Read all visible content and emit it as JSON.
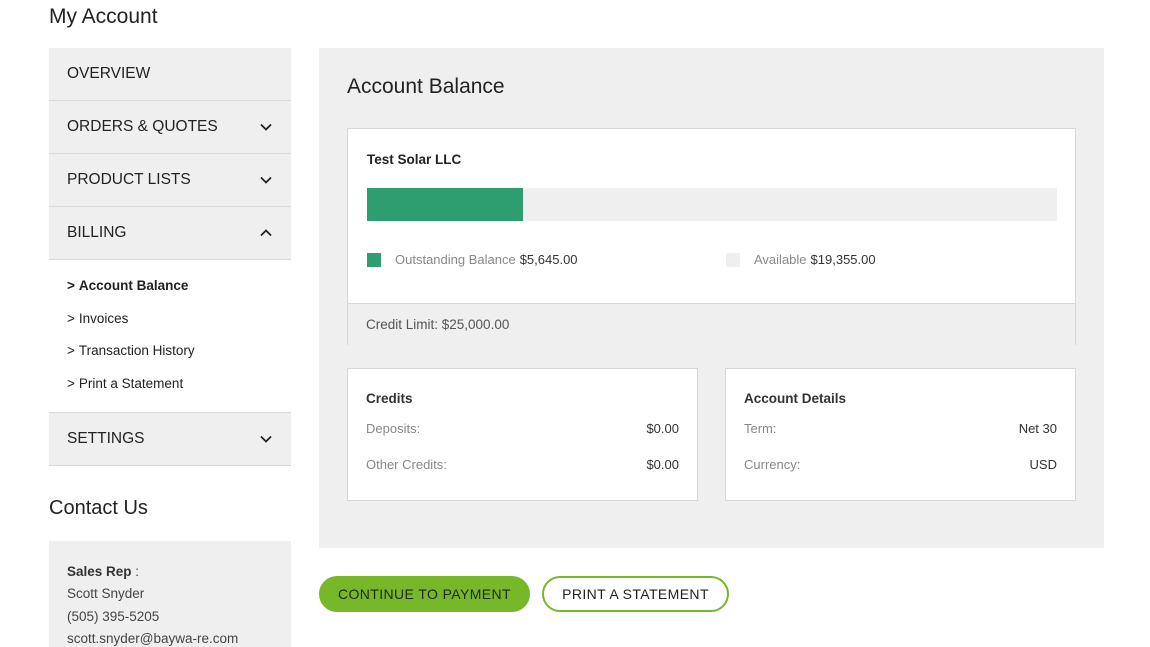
{
  "page": {
    "title": "My Account"
  },
  "sidebar": {
    "items": [
      {
        "label": "OVERVIEW"
      },
      {
        "label": "ORDERS & QUOTES"
      },
      {
        "label": "PRODUCT LISTS"
      },
      {
        "label": "BILLING"
      },
      {
        "label": "SETTINGS"
      }
    ],
    "billing_sub": [
      {
        "prefix": ">",
        "label": "Account Balance"
      },
      {
        "prefix": ">",
        "label": "Invoices"
      },
      {
        "prefix": ">",
        "label": "Transaction History"
      },
      {
        "prefix": ">",
        "label": "Print a Statement"
      }
    ]
  },
  "contact": {
    "title": "Contact Us",
    "rep_label": "Sales Rep",
    "rep_sep": " :",
    "name": "Scott Snyder",
    "phone": "(505) 395-5205",
    "email": "scott.snyder@baywa-re.com"
  },
  "main": {
    "title": "Account Balance",
    "company": "Test Solar LLC",
    "progress_fraction": 0.2258,
    "outstanding_label": "Outstanding Balance",
    "outstanding_value": "$5,645.00",
    "available_label": "Available",
    "available_value": "$19,355.00",
    "credit_limit": "Credit Limit: $25,000.00"
  },
  "credits": {
    "title": "Credits",
    "rows": [
      {
        "label": "Deposits:",
        "value": "$0.00"
      },
      {
        "label": "Other Credits:",
        "value": "$0.00"
      }
    ]
  },
  "account_details": {
    "title": "Account Details",
    "rows": [
      {
        "label": "Term:",
        "value": "Net 30"
      },
      {
        "label": "Currency:",
        "value": "USD"
      }
    ]
  },
  "buttons": {
    "continue": "CONTINUE TO PAYMENT",
    "print": "PRINT A STATEMENT"
  },
  "colors": {
    "outstanding": "#2e9d70",
    "available": "#efefef",
    "accent": "#77b82a"
  },
  "icons": {
    "collapsed": "chevron-down-icon",
    "expanded": "chevron-up-icon"
  }
}
